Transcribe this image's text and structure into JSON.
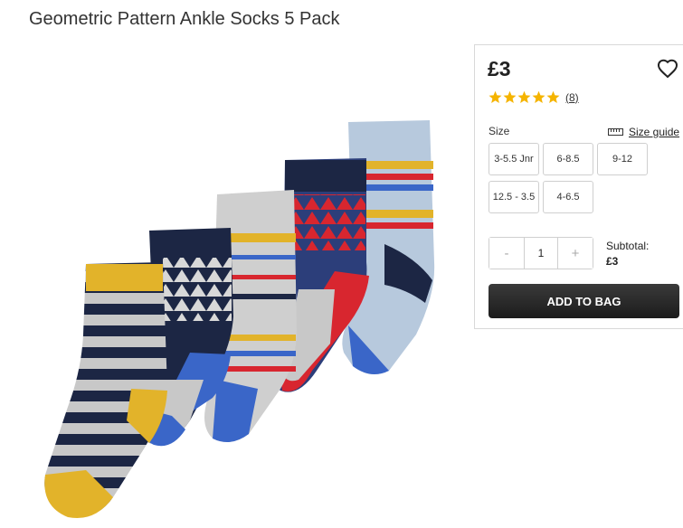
{
  "product": {
    "title": "Geometric Pattern Ankle Socks 5 Pack",
    "price": "£3",
    "rating": {
      "stars": 5,
      "max": 5,
      "review_count": "(8)"
    },
    "image_alt": "Five pairs of geometric pattern ankle socks"
  },
  "size": {
    "label": "Size",
    "guide_label": "Size guide",
    "options": [
      "3-5.5 Jnr",
      "6-8.5",
      "9-12",
      "12.5 - 3.5",
      "4-6.5"
    ]
  },
  "quantity": {
    "minus": "-",
    "value": "1",
    "plus": "+"
  },
  "subtotal": {
    "label": "Subtotal:",
    "value": "£3"
  },
  "actions": {
    "add_to_bag": "ADD TO BAG"
  },
  "colors": {
    "star": "#f5b400",
    "button_dark": "#222222",
    "sock_navy": "#1c2644",
    "sock_mustard": "#e2b32a",
    "sock_grey": "#c9c9c9",
    "sock_blue": "#3a66c8",
    "sock_red": "#d8262f",
    "sock_lightblue": "#a9c3de"
  },
  "icons": {
    "wishlist": "heart-icon",
    "size_guide": "ruler-icon",
    "rating": "star-icon"
  }
}
